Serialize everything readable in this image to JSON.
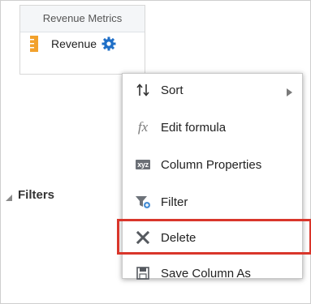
{
  "columns_panel": {
    "header": "Revenue Metrics",
    "item_label": "Revenue"
  },
  "filters": {
    "label": "Filters"
  },
  "context_menu": {
    "items": [
      {
        "label": "Sort",
        "icon": "sort-icon",
        "has_submenu": true
      },
      {
        "label": "Edit formula",
        "icon": "fx-icon"
      },
      {
        "label": "Column Properties",
        "icon": "xyz-icon",
        "icon_text": "xyz"
      },
      {
        "label": "Filter",
        "icon": "filter-icon"
      },
      {
        "label": "Delete",
        "icon": "x-icon",
        "highlighted": true
      },
      {
        "label": "Save Column As",
        "icon": "save-icon"
      }
    ]
  },
  "colors": {
    "gear_blue": "#1f6fc7",
    "measure_orange": "#f2a12c",
    "highlight_red": "#d9362b"
  }
}
